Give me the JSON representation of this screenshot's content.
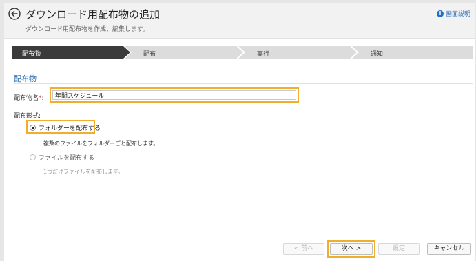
{
  "header": {
    "title": "ダウンロード用配布物の追加",
    "subtitle": "ダウンロード用配布物を作成、編集します。",
    "help_label": "画面説明"
  },
  "stepper": {
    "steps": [
      {
        "label": "配布物",
        "state": "active"
      },
      {
        "label": "配布",
        "state": "inactive"
      },
      {
        "label": "実行",
        "state": "inactive"
      },
      {
        "label": "通知",
        "state": "inactive"
      }
    ]
  },
  "form": {
    "section_title": "配布物",
    "name_label": "配布物名",
    "required_mark": "*",
    "name_colon": ":",
    "name_value": "年間スケジュール",
    "format_label": "配布形式:",
    "options": [
      {
        "label": "フォルダーを配布する",
        "description": "複数のファイルをフォルダーごと配布します。",
        "checked": true
      },
      {
        "label": "ファイルを配布する",
        "description": "1つだけファイルを配布します。",
        "checked": false
      }
    ]
  },
  "footer": {
    "prev_label": "< 前へ",
    "next_label": "次へ >",
    "settings_label": "設定",
    "cancel_label": "キャンセル"
  },
  "colors": {
    "accent": "#2a6db5",
    "highlight": "#f0ad2e",
    "active_step": "#3b3b3b",
    "inactive_step": "#dcdcdc"
  }
}
